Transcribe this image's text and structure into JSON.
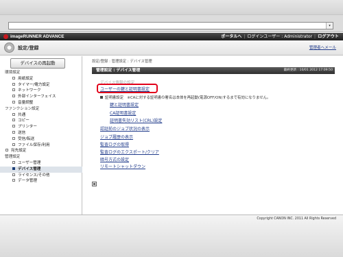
{
  "browser": {
    "url": "",
    "dropdown_glyph": "▾"
  },
  "header": {
    "logo_text": "imageRUNNER ADVANCE",
    "portal_link": "ポータルへ",
    "login_user_label": "ログインユーザー : Administrator",
    "logout_link": "ログアウト"
  },
  "subheader": {
    "title": "設定/登録",
    "admin_link": "管理者へメール"
  },
  "sidebar": {
    "restart_button": "デバイスの再起動",
    "items": [
      {
        "label": "環境設定",
        "kind": "section"
      },
      {
        "label": "用紙設定",
        "kind": "item"
      },
      {
        "label": "タイマー/電力設定",
        "kind": "item"
      },
      {
        "label": "ネットワーク",
        "kind": "item"
      },
      {
        "label": "外部インターフェイス",
        "kind": "item"
      },
      {
        "label": "音量調整",
        "kind": "item"
      },
      {
        "label": "ファンクション設定",
        "kind": "section"
      },
      {
        "label": "共通",
        "kind": "item"
      },
      {
        "label": "コピー",
        "kind": "item"
      },
      {
        "label": "プリンター",
        "kind": "item"
      },
      {
        "label": "送信",
        "kind": "item"
      },
      {
        "label": "受信/転送",
        "kind": "item"
      },
      {
        "label": "ファイル保存/利用",
        "kind": "item"
      },
      {
        "label": "宛先設定",
        "kind": "top-item"
      },
      {
        "label": "管理設定",
        "kind": "section"
      },
      {
        "label": "ユーザー管理",
        "kind": "item"
      },
      {
        "label": "デバイス管理",
        "kind": "item",
        "active": true
      },
      {
        "label": "ライセンス/その他",
        "kind": "item"
      },
      {
        "label": "データ管理",
        "kind": "item"
      }
    ]
  },
  "main": {
    "breadcrumb": "設定/登録 : 管理設定 : デバイス管理",
    "title": "管理設定 : デバイス管理",
    "last_updated": "最終更新 : 10/01 2012 17:09:50",
    "faded_link": "デバイス情報の設定",
    "highlight_link": "ユーザーの鍵と証明書設定",
    "note": "証明書設定　※CAに対する証明書の署名は本体を再起動(電源OFF/ON)するまで有効になりません。",
    "sub_links": [
      "鍵と証明書設定",
      "CA証明書設定",
      "証明書失効リスト(CRL)設定"
    ],
    "links": [
      "認証前のジョブ状況の表示",
      "ジョブ履歴の表示",
      "監査ログの取得",
      "監査ログのエクスポート/クリア",
      "暗号方式の設定",
      "リモートシャットダウン"
    ]
  },
  "footer": {
    "copyright": "Copyright CANON INC. 2011 All Rights Reserved"
  },
  "colors": {
    "highlight": "#e2001a",
    "link": "#1f3a8a",
    "header_bg": "#2a2a2a",
    "active_item_bg": "#dde3ea"
  }
}
